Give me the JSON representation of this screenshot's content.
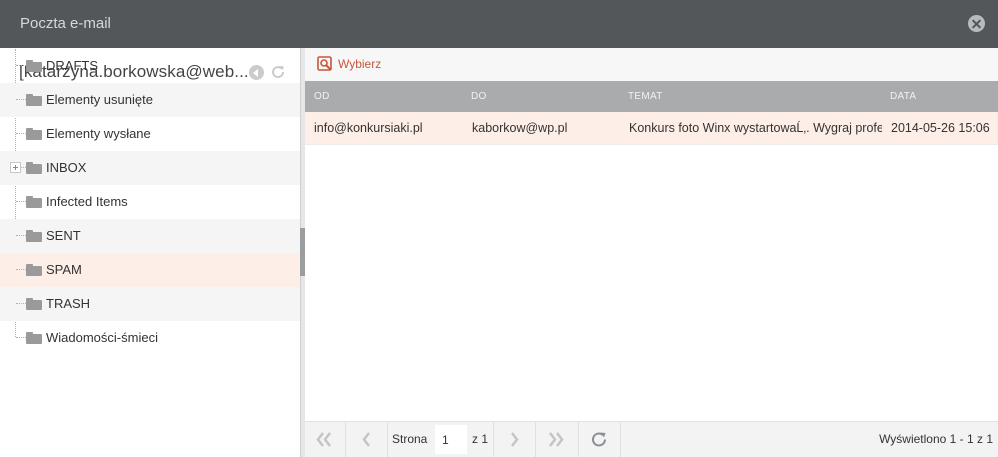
{
  "window": {
    "title": "Poczta e-mail"
  },
  "account": {
    "name": "[katarzyna.borkowska@web..."
  },
  "folders": [
    {
      "label": "DRAFTS"
    },
    {
      "label": "Elementy usunięte"
    },
    {
      "label": "Elementy wysłane"
    },
    {
      "label": "INBOX",
      "expandable": true
    },
    {
      "label": "Infected Items"
    },
    {
      "label": "SENT"
    },
    {
      "label": "SPAM",
      "selected": true
    },
    {
      "label": "TRASH"
    },
    {
      "label": "Wiadomości-śmieci"
    }
  ],
  "toolbar": {
    "select_label": "Wybierz",
    "select_icon": "search-select-icon"
  },
  "grid": {
    "columns": [
      "OD",
      "DO",
      "TEMAT",
      "DATA"
    ],
    "rows": [
      {
        "from": "info@konkursiaki.pl",
        "to": "kaborkow@wp.pl",
        "subject": "Konkurs foto Winx wystartowaĹ‚. Wygraj profes",
        "date": "2014-05-26 15:06"
      }
    ]
  },
  "pager": {
    "page_label": "Strona",
    "page_value": "1",
    "of_label": "z 1",
    "display_info": "Wyświetlono 1 - 1 z 1"
  },
  "colors": {
    "titlebar": "#54575a",
    "accent": "#c9553a",
    "selected_row": "#fdeee8",
    "grid_header": "#a9abad"
  }
}
